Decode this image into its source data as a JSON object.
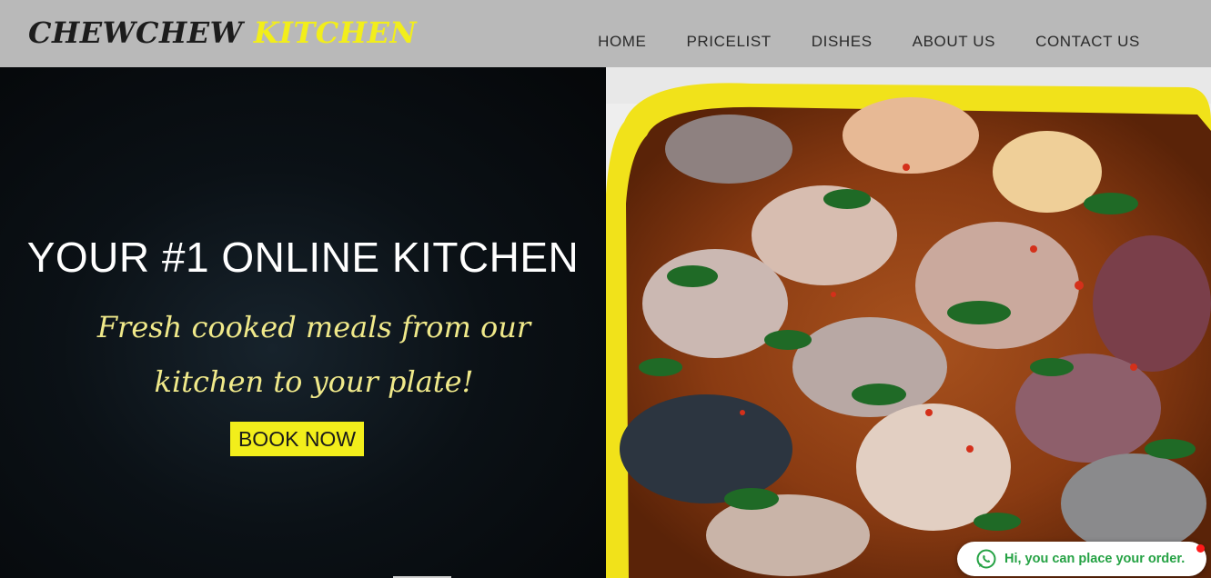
{
  "brand": {
    "part1": "CHEWCHEW",
    "part2": "KITCHEN",
    "colors": {
      "part1": "#1c1c1c",
      "part2": "#f2ee1b"
    }
  },
  "nav": {
    "items": [
      {
        "label": "HOME"
      },
      {
        "label": "PRICELIST"
      },
      {
        "label": "DISHES"
      },
      {
        "label": "ABOUT US"
      },
      {
        "label": "CONTACT US"
      }
    ]
  },
  "hero": {
    "title": "YOUR #1 ONLINE KITCHEN",
    "subtitle_line1": "Fresh cooked meals from our",
    "subtitle_line2": "kitchen to your plate!",
    "cta_label": "BOOK NOW",
    "image_icon": "food-photo-pepper-soup",
    "colors": {
      "cta_bg": "#f2ee1b",
      "subtitle": "#f0e98a",
      "header_bg": "#b9b9b9"
    }
  },
  "whatsapp": {
    "icon": "whatsapp-icon",
    "text": "Hi, you can place your order.",
    "colors": {
      "text": "#25a244",
      "notification": "#ff1a1a"
    }
  }
}
